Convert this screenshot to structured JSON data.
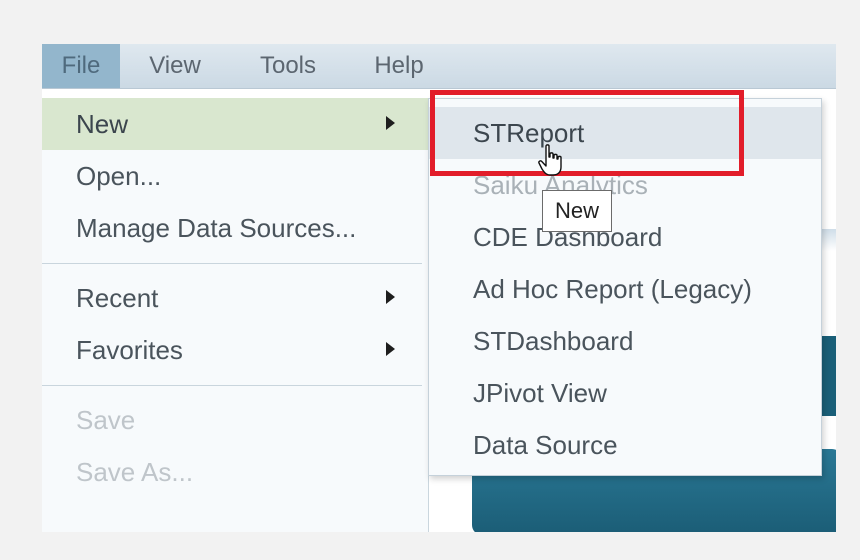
{
  "menubar": {
    "items": [
      {
        "label": "File"
      },
      {
        "label": "View"
      },
      {
        "label": "Tools"
      },
      {
        "label": "Help"
      }
    ]
  },
  "file_menu": {
    "items": [
      {
        "label": "New",
        "has_submenu": true,
        "state": "highlighted"
      },
      {
        "label": "Open...",
        "has_submenu": false,
        "state": "normal"
      },
      {
        "label": "Manage Data Sources...",
        "has_submenu": false,
        "state": "normal"
      },
      {
        "label": "Recent",
        "has_submenu": true,
        "state": "normal"
      },
      {
        "label": "Favorites",
        "has_submenu": true,
        "state": "normal"
      },
      {
        "label": "Save",
        "has_submenu": false,
        "state": "disabled"
      },
      {
        "label": "Save As...",
        "has_submenu": false,
        "state": "disabled"
      }
    ]
  },
  "new_submenu": {
    "items": [
      {
        "label": "STReport",
        "state": "hovered"
      },
      {
        "label": "Saiku Analytics",
        "state": "normal"
      },
      {
        "label": "CDE Dashboard",
        "state": "normal"
      },
      {
        "label": "Ad Hoc Report (Legacy)",
        "state": "normal"
      },
      {
        "label": "STDashboard",
        "state": "normal"
      },
      {
        "label": "JPivot View",
        "state": "normal"
      },
      {
        "label": "Data Source",
        "state": "normal"
      }
    ]
  },
  "tooltip": {
    "text": "New"
  },
  "colors": {
    "highlight_green": "#d9e7cf",
    "menubar_active": "#93b6cc",
    "annotation_red": "#e21d2a"
  },
  "icons": {
    "submenu_arrow": "triangle-right-icon",
    "cursor": "hand-pointer-icon"
  }
}
